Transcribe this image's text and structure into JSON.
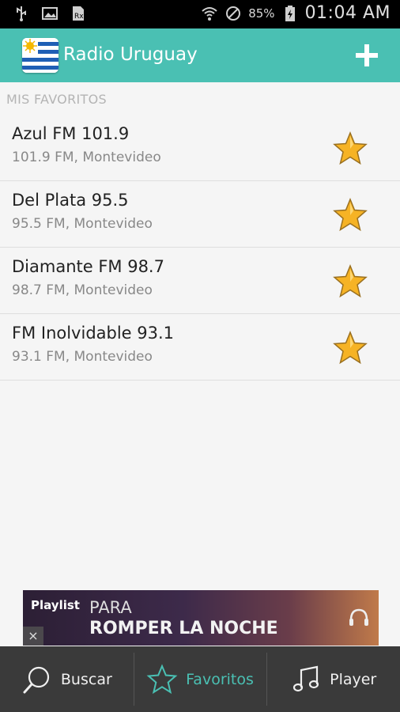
{
  "status_bar": {
    "icons": [
      "usb-icon",
      "image-icon",
      "rx-icon",
      "wifi-icon",
      "do-not-disturb-icon",
      "battery-icon"
    ],
    "battery": "85%",
    "time": "01:04 AM"
  },
  "app_bar": {
    "title": "Radio Uruguay",
    "flag_icon": "uruguay-flag-icon",
    "add_icon": "plus-icon",
    "color": "#4ac0b3"
  },
  "section_header": "MIS FAVORITOS",
  "stations": [
    {
      "name": "Azul FM 101.9",
      "detail": "101.9 FM, Montevideo"
    },
    {
      "name": "Del Plata 95.5",
      "detail": "95.5 FM, Montevideo"
    },
    {
      "name": "Diamante FM 98.7",
      "detail": "98.7 FM, Montevideo"
    },
    {
      "name": "FM Inolvidable 93.1",
      "detail": "93.1 FM, Montevideo"
    }
  ],
  "ad": {
    "brand": "Playlist",
    "line1": "PARA",
    "line2": "ROMPER LA NOCHE",
    "close": "×"
  },
  "tabs": [
    {
      "label": "Buscar",
      "icon": "search-icon"
    },
    {
      "label": "Favoritos",
      "icon": "star-outline-icon",
      "active": true
    },
    {
      "label": "Player",
      "icon": "music-note-icon"
    }
  ]
}
